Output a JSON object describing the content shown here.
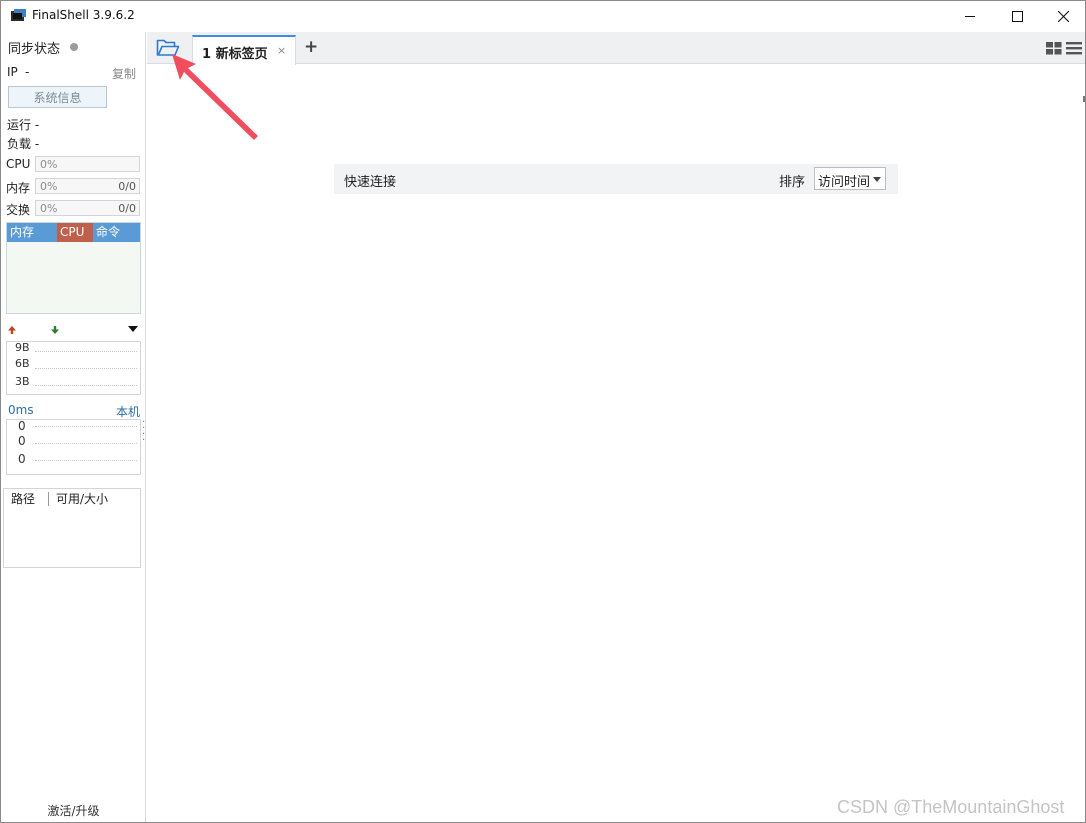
{
  "window": {
    "title": "FinalShell 3.9.6.2",
    "icon": "finalshell-app-icon",
    "controls": [
      "minimize-icon",
      "maximize-icon",
      "close-icon"
    ]
  },
  "sidebar": {
    "sync_label": "同步状态",
    "ip_label": "IP",
    "ip_value": "-",
    "copy_label": "复制",
    "sysinfo_button": "系统信息",
    "run_label": "运行 -",
    "load_label": "负载 -",
    "meters": {
      "cpu": {
        "label": "CPU",
        "percent": "0%",
        "amount": ""
      },
      "mem": {
        "label": "内存",
        "percent": "0%",
        "amount": "0/0"
      },
      "swap": {
        "label": "交换",
        "percent": "0%",
        "amount": "0/0"
      }
    },
    "process_tabs": [
      "内存",
      "CPU",
      "命令"
    ],
    "network": {
      "up_icon": "arrow-up-icon",
      "down_icon": "arrow-down-icon",
      "ticks": [
        "9B",
        "6B",
        "3B"
      ]
    },
    "ping": {
      "latency": "0ms",
      "target": "本机",
      "values": [
        "0",
        "0",
        "0"
      ]
    },
    "disk": {
      "col_path": "路径",
      "col_size": "可用/大小"
    },
    "activate_label": "激活/升级"
  },
  "tabs": {
    "folder_icon": "folder-open-icon",
    "items": [
      {
        "label": "1 新标签页",
        "close": "×"
      }
    ],
    "add_label": "+",
    "view_icons": [
      "grid-view-icon",
      "list-view-icon"
    ]
  },
  "quick_connect": {
    "label": "快速连接",
    "sort_label": "排序",
    "sort_value": "访问时间"
  },
  "watermark": "CSDN @TheMountainGhost",
  "colors": {
    "accent": "#3a8ee6",
    "arrow": "#f04e5e",
    "process_header": "#5b9bd5",
    "cpu_tab": "#c0604c"
  }
}
